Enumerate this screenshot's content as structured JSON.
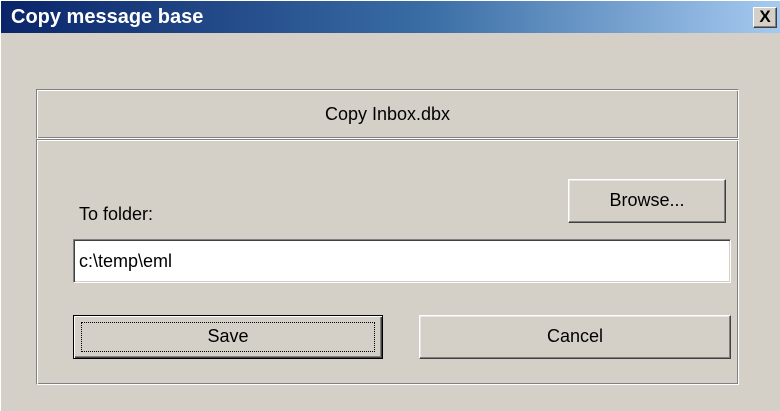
{
  "window": {
    "title": "Copy message base",
    "close_label": "X"
  },
  "header": {
    "text": "Copy Inbox.dbx"
  },
  "form": {
    "folder_label": "To folder:",
    "folder_value": "c:\\temp\\eml",
    "browse_label": "Browse...",
    "save_label": "Save",
    "cancel_label": "Cancel"
  },
  "colors": {
    "titlebar_start": "#0a246a",
    "titlebar_end": "#a6caf0",
    "face": "#d4d0c8"
  }
}
